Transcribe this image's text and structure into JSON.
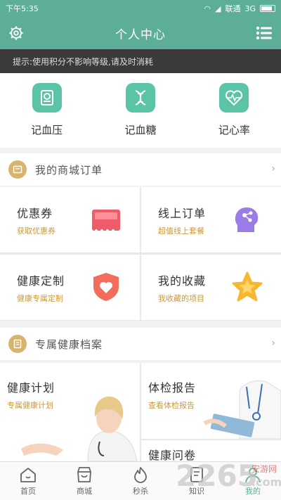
{
  "status_bar": {
    "time": "下午5:35",
    "carrier": "联通",
    "network": "3G",
    "icons": [
      "wifi-icon",
      "signal-icon",
      "battery-icon"
    ]
  },
  "header": {
    "title": "个人中心",
    "left_icon": "gear-icon",
    "right_icon": "list-menu-icon"
  },
  "notice": {
    "text": "提示:使用积分不影响等级,请及时消耗"
  },
  "quick_actions": [
    {
      "label": "记血压",
      "icon": "blood-pressure-icon"
    },
    {
      "label": "记血糖",
      "icon": "dna-icon"
    },
    {
      "label": "记心率",
      "icon": "heart-rate-icon"
    }
  ],
  "mall_orders": {
    "title": "我的商城订单",
    "items": [
      {
        "title": "优惠券",
        "subtitle": "获取优惠券",
        "icon": "coupon-icon"
      },
      {
        "title": "线上订单",
        "subtitle": "超值线上套餐",
        "icon": "head-network-icon"
      },
      {
        "title": "健康定制",
        "subtitle": "健康专属定制",
        "icon": "shield-heart-icon"
      },
      {
        "title": "我的收藏",
        "subtitle": "我收藏的项目",
        "icon": "star-icon"
      }
    ]
  },
  "health_records": {
    "title": "专属健康档案",
    "plan": {
      "title": "健康计划",
      "subtitle": "专属健康计划"
    },
    "report": {
      "title": "体检报告",
      "subtitle": "查看体检报告"
    },
    "ask": {
      "title": "健康问卷"
    }
  },
  "tabbar": [
    {
      "label": "首页",
      "icon": "home-icon"
    },
    {
      "label": "商城",
      "icon": "shop-icon"
    },
    {
      "label": "秒杀",
      "icon": "flame-icon"
    },
    {
      "label": "知识",
      "icon": "book-icon"
    },
    {
      "label": "我的",
      "icon": "user-icon",
      "active": true
    }
  ],
  "watermark": {
    "number": "2265",
    "text": "安游网",
    "suffix": ".com"
  },
  "colors": {
    "primary": "#5cae98",
    "icon_green": "#5cc4a6",
    "gold": "#d6b46d",
    "subtitle": "#c99a3b",
    "notice_bg": "#3a3a3a"
  }
}
